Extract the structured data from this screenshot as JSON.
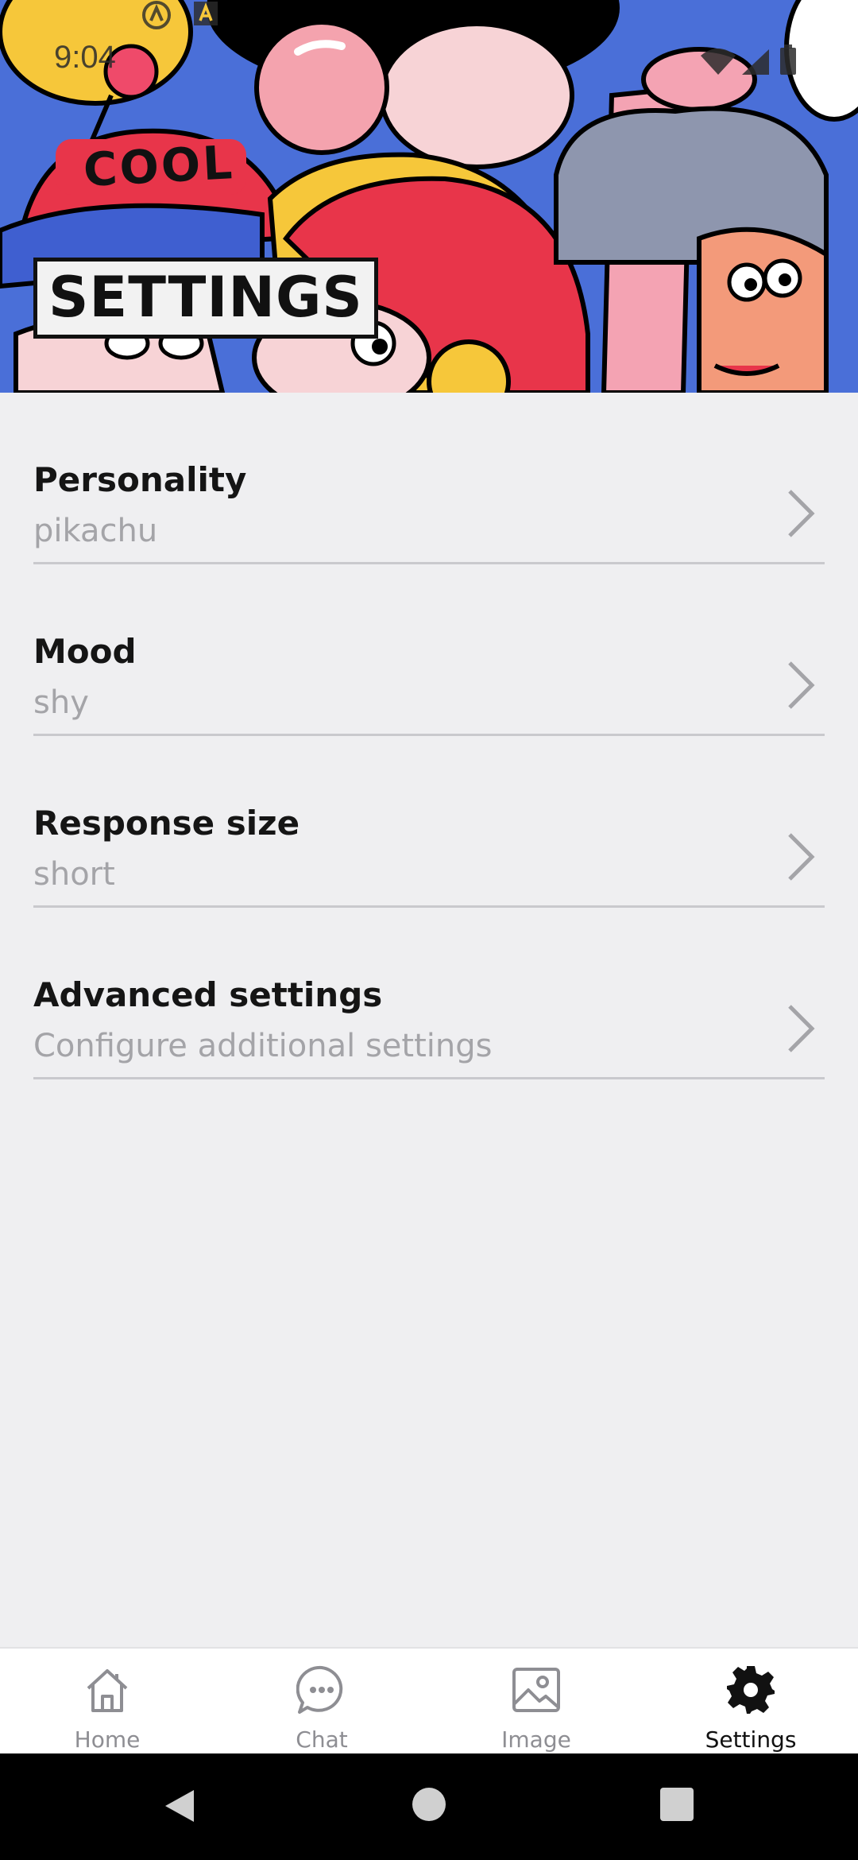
{
  "status_bar": {
    "time": "9:04"
  },
  "hero": {
    "title": "SETTINGS",
    "illustration_text": "COOL"
  },
  "settings": [
    {
      "title": "Personality",
      "value": "pikachu"
    },
    {
      "title": "Mood",
      "value": "shy"
    },
    {
      "title": "Response size",
      "value": "short"
    },
    {
      "title": "Advanced settings",
      "value": "Configure additional settings"
    }
  ],
  "tabs": [
    {
      "label": "Home",
      "icon": "home-icon"
    },
    {
      "label": "Chat",
      "icon": "chat-bubble-icon"
    },
    {
      "label": "Image",
      "icon": "image-icon"
    },
    {
      "label": "Settings",
      "icon": "gear-icon",
      "active": true
    }
  ],
  "colors": {
    "background": "#efeff1",
    "accent": "#111111",
    "muted": "#a4a4a8",
    "divider": "#c9c9cd"
  }
}
